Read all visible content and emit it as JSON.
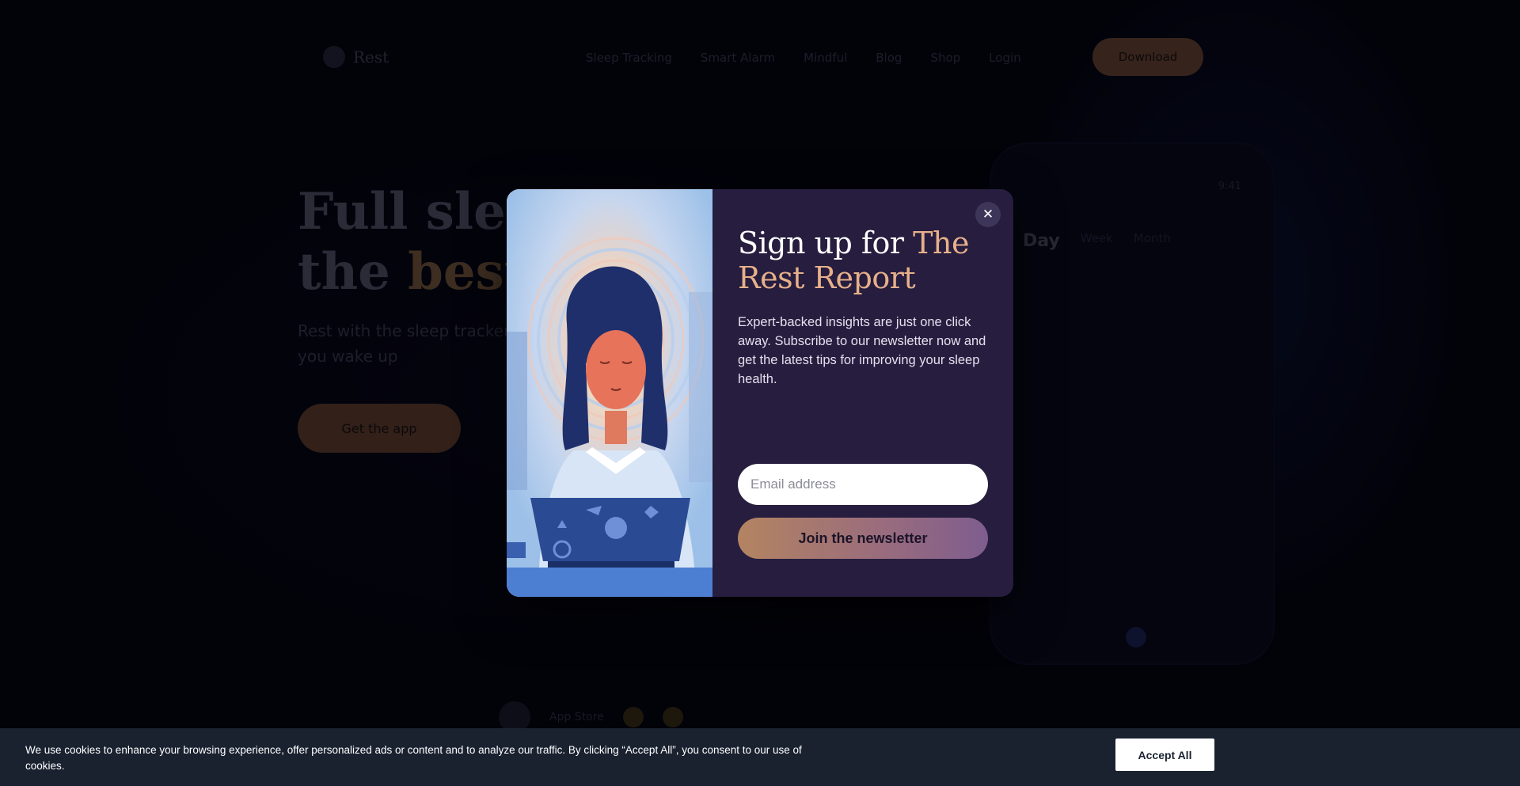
{
  "background_page": {
    "logo_text": "Rest",
    "nav_items": [
      "Sleep Tracking",
      "Smart Alarm",
      "Mindful",
      "Blog",
      "Shop",
      "Login"
    ],
    "nav_cta": "Download",
    "hero_title_line1": "Full sleep",
    "hero_title_line2_prefix": "the",
    "hero_title_line2_accent": "best",
    "hero_subtitle": "Rest with the sleep tracker that knows you and helps you wake up",
    "hero_button": "Get the app",
    "phone_time": "9:41",
    "phone_tabs": [
      "Day",
      "Week",
      "Month"
    ],
    "bottom_text": "App Store"
  },
  "modal": {
    "title_prefix": "Sign up for ",
    "title_accent": "The Rest Report",
    "description": "Expert-backed insights are just one click away. Subscribe to our newsletter now and get the latest tips for improving your sleep health.",
    "email_placeholder": "Email address",
    "submit_label": "Join the newsletter",
    "close_label": "✕"
  },
  "cookie_banner": {
    "text": "We use cookies to enhance your browsing experience, offer personalized ads or content and to analyze our traffic. By clicking “Accept All”, you consent to our use of cookies.",
    "accept_label": "Accept All"
  }
}
